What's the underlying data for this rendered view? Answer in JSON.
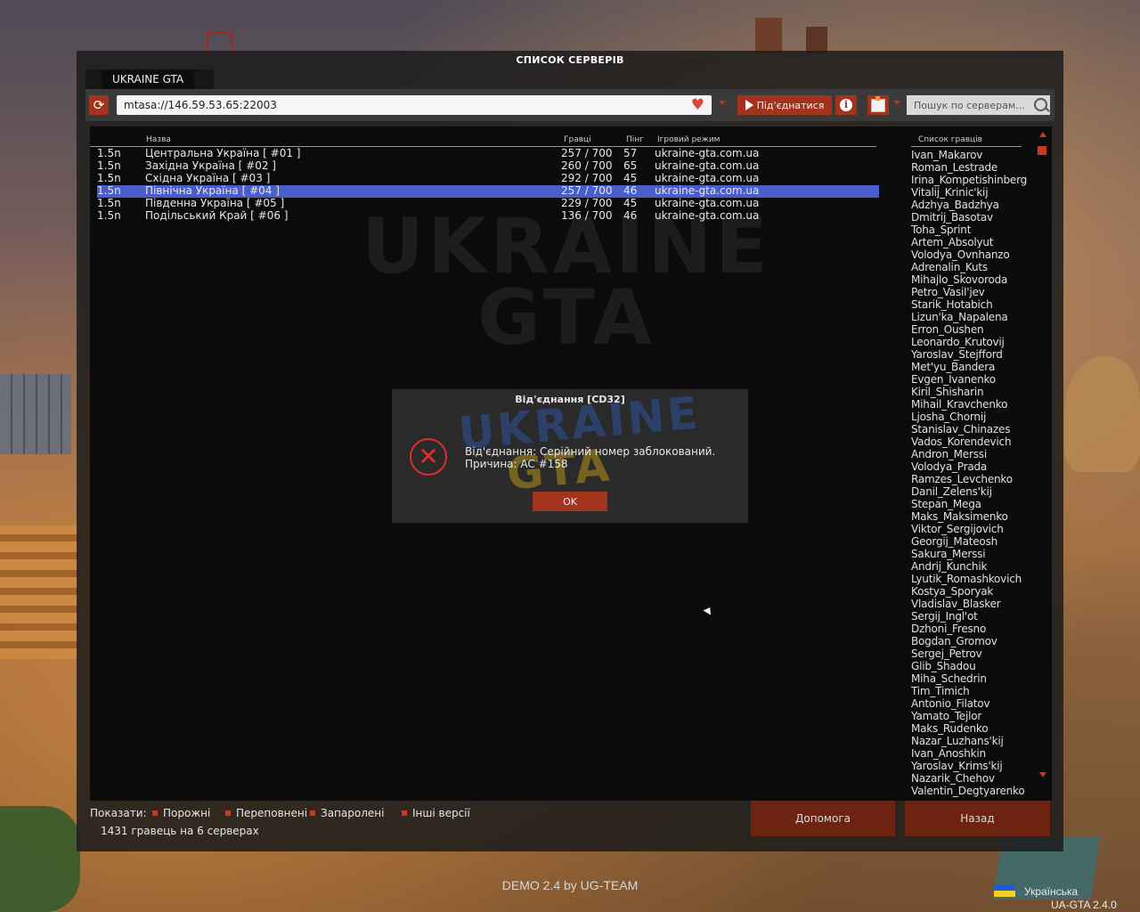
{
  "window": {
    "title": "СПИСОК СЕРВЕРІВ",
    "tab": "UKRAINE GTA"
  },
  "toolbar": {
    "address": "mtasa://146.59.53.65:22003",
    "connect_label": "Під'єднатися",
    "search_placeholder": "Пошук по серверам..."
  },
  "columns": {
    "name": "Назва",
    "players": "Гравці",
    "ping": "Пінг",
    "mode": "Ігровий режим"
  },
  "servers": [
    {
      "version": "1.5n",
      "name": "Центральна Україна [ #01 ]",
      "players": "257 / 700",
      "ping": "57",
      "mode": "ukraine-gta.com.ua"
    },
    {
      "version": "1.5n",
      "name": "Західна Україна [ #02 ]",
      "players": "260 / 700",
      "ping": "65",
      "mode": "ukraine-gta.com.ua"
    },
    {
      "version": "1.5n",
      "name": "Східна Україна [ #03 ]",
      "players": "292 / 700",
      "ping": "45",
      "mode": "ukraine-gta.com.ua"
    },
    {
      "version": "1.5n",
      "name": "Північна Україна [ #04 ]",
      "players": "257 / 700",
      "ping": "46",
      "mode": "ukraine-gta.com.ua"
    },
    {
      "version": "1.5n",
      "name": "Південна Україна [ #05 ]",
      "players": "229 / 700",
      "ping": "45",
      "mode": "ukraine-gta.com.ua"
    },
    {
      "version": "1.5n",
      "name": "Подільський Край [ #06 ]",
      "players": "136 / 700",
      "ping": "46",
      "mode": "ukraine-gta.com.ua"
    }
  ],
  "selected_server": 3,
  "players_panel": {
    "header": "Список гравців",
    "players": [
      "Ivan_Makarov",
      "Roman_Lestrade",
      "Irina_Kompetishinberg",
      "Vitalij_Krinic'kij",
      "Adzhya_Badzhya",
      "Dmitrij_Basotav",
      "Toha_Sprint",
      "Artem_Absolyut",
      "Volodya_Ovnhanzo",
      "Adrenalin_Kuts",
      "Mihajlo_Skovoroda",
      "Petro_Vasil'jev",
      "Starik_Hotabich",
      "Lizun'ka_Napalena",
      "Erron_Oushen",
      "Leonardo_Krutovij",
      "Yaroslav_Stejfford",
      "Met'yu_Bandera",
      "Evgen_Ivanenko",
      "Kiril_Shisharin",
      "Mihail_Kravchenko",
      "Ljosha_Chornij",
      "Stanislav_Chinazes",
      "Vados_Korendevich",
      "Andron_Merssi",
      "Volodya_Prada",
      "Ramzes_Levchenko",
      "Danil_Zelens'kij",
      "Stepan_Mega",
      "Maks_Maksimenko",
      "Viktor_Sergijovich",
      "Georgij_Mateosh",
      "Sakura_Merssi",
      "Andrij_Kunchik",
      "Lyutik_Romashkovich",
      "Kostya_Sporyak",
      "Vladislav_Blasker",
      "Sergij_Ingl'ot",
      "Dzhoni_Fresno",
      "Bogdan_Gromov",
      "Sergej_Petrov",
      "Glib_Shadou",
      "Miha_Schedrin",
      "Tim_Timich",
      "Antonio_Filatov",
      "Yamato_Tejlor",
      "Maks_Rudenko",
      "Nazar_Luzhans'kij",
      "Ivan_Anoshkin",
      "Yaroslav_Krims'kij",
      "Nazarik_Chehov",
      "Valentin_Degtyarenko"
    ]
  },
  "dialog": {
    "title": "Від'єднання [CD32]",
    "line1": "Від'єднання: Серійний номер заблокований.",
    "line2": "Причина: AC #158",
    "ok_label": "OK"
  },
  "filters": {
    "show_label": "Показати:",
    "items": [
      "Порожні",
      "Переповнені",
      "Запаролені",
      "Інші версії"
    ],
    "counter": "1431 гравець на 6 серверах"
  },
  "buttons": {
    "help": "Допомога",
    "back": "Назад"
  },
  "footer": {
    "demo": "DEMO 2.4 by UG-TEAM",
    "language": "Українська",
    "version": "UA-GTA 2.4.0"
  },
  "colors": {
    "accent": "#a3331d",
    "selection": "#4a5ecb",
    "error": "#e02d2d"
  }
}
